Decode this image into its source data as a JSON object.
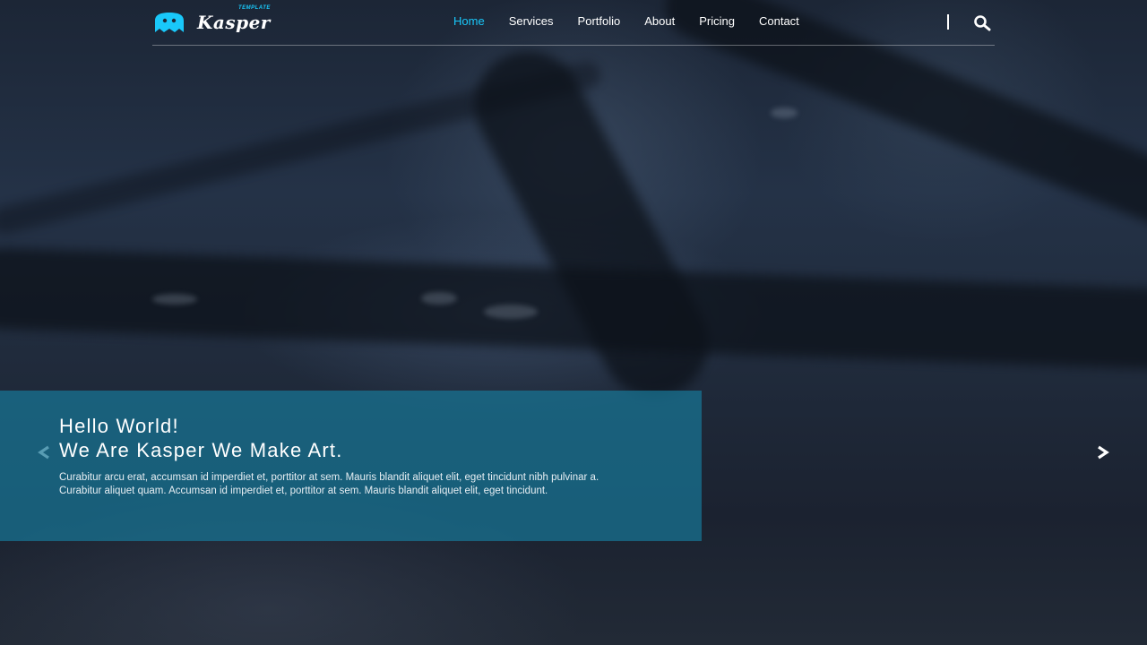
{
  "brand": {
    "name": "Kasper",
    "tag": "TEMPLATE",
    "accent_color": "#19c8fa"
  },
  "nav": {
    "items": [
      {
        "label": "Home",
        "active": true
      },
      {
        "label": "Services",
        "active": false
      },
      {
        "label": "Portfolio",
        "active": false
      },
      {
        "label": "About",
        "active": false
      },
      {
        "label": "Pricing",
        "active": false
      },
      {
        "label": "Contact",
        "active": false
      }
    ],
    "search_icon": "search-icon"
  },
  "slide": {
    "title_line1": "Hello World!",
    "title_line2": "We Are Kasper We Make Art.",
    "text": "Curabitur arcu erat, accumsan id imperdiet et, porttitor at sem. Mauris blandit aliquet elit, eget tincidunt nibh pulvinar a. Curabitur aliquet quam. Accumsan id imperdiet et, porttitor at sem. Mauris blandit aliquet elit, eget tincidunt.",
    "box_color": "#1876960"
  },
  "controls": {
    "prev_icon": "chevron-left-icon",
    "next_icon": "chevron-right-icon"
  }
}
